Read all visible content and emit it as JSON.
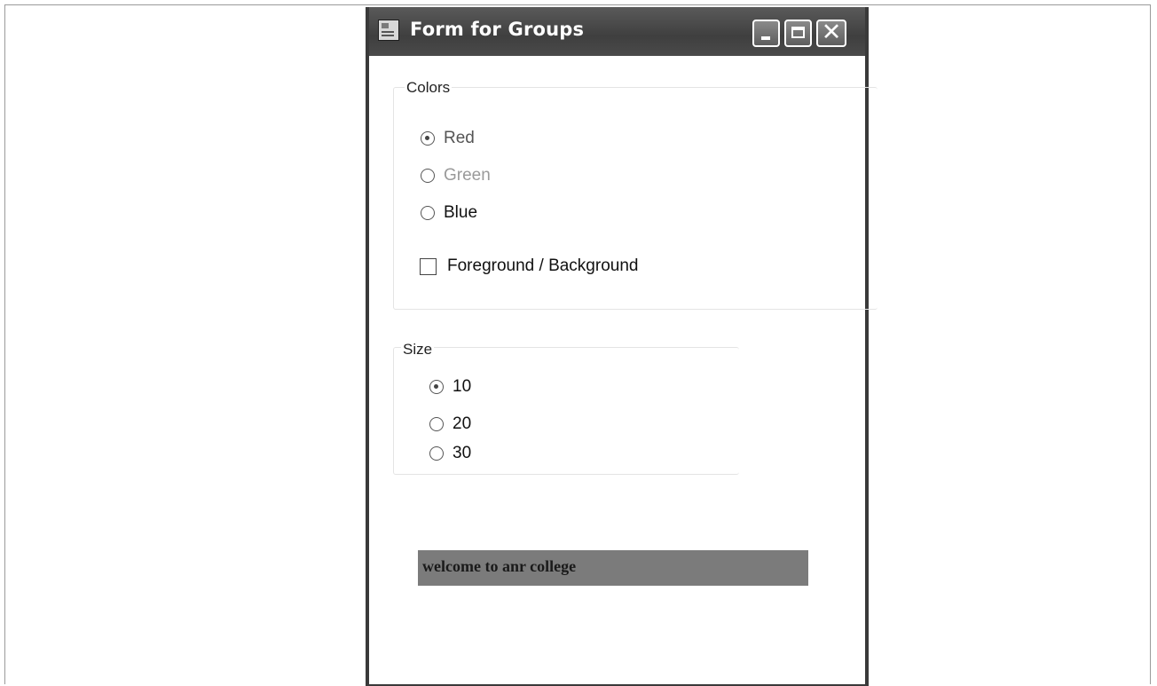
{
  "window": {
    "title": "Form for Groups",
    "icon": "form-app-icon",
    "caption_buttons": [
      "minimize-icon",
      "maximize-icon",
      "close-icon"
    ],
    "close_glyph": "✕"
  },
  "colors_group": {
    "label": "Colors",
    "options": [
      {
        "label": "Red",
        "checked": true
      },
      {
        "label": "Green",
        "checked": false
      },
      {
        "label": "Blue",
        "checked": false
      }
    ],
    "checkbox": {
      "label": "Foreground / Background",
      "checked": false
    }
  },
  "size_group": {
    "label": "Size",
    "options": [
      {
        "label": "10",
        "checked": true
      },
      {
        "label": "20",
        "checked": false
      },
      {
        "label": "30",
        "checked": false
      }
    ]
  },
  "welcome_label": "welcome to anr college"
}
